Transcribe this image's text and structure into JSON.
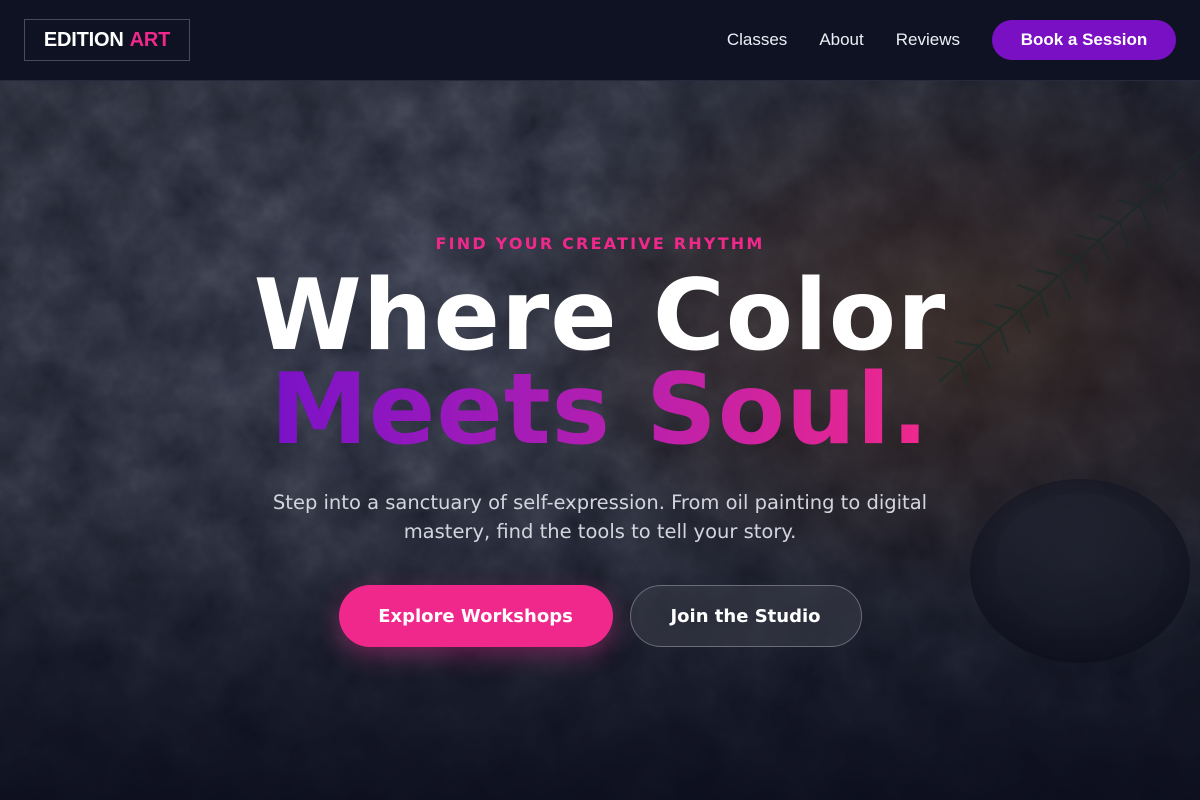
{
  "header": {
    "logo_primary": "EDITION",
    "logo_accent": "ART",
    "nav": [
      "Classes",
      "About",
      "Reviews"
    ],
    "cta_label": "Book a Session"
  },
  "hero": {
    "eyebrow": "FIND YOUR CREATIVE RHYTHM",
    "headline_line1": "Where Color",
    "headline_line2": "Meets Soul.",
    "subtitle": "Step into a sanctuary of self-expression. From oil painting to digital mastery, find the tools to tell your story.",
    "primary_cta": "Explore Workshops",
    "secondary_cta": "Join the Studio"
  },
  "colors": {
    "accent_pink": "#f0288c",
    "accent_purple": "#7a10c4",
    "header_bg": "#0e1222"
  }
}
